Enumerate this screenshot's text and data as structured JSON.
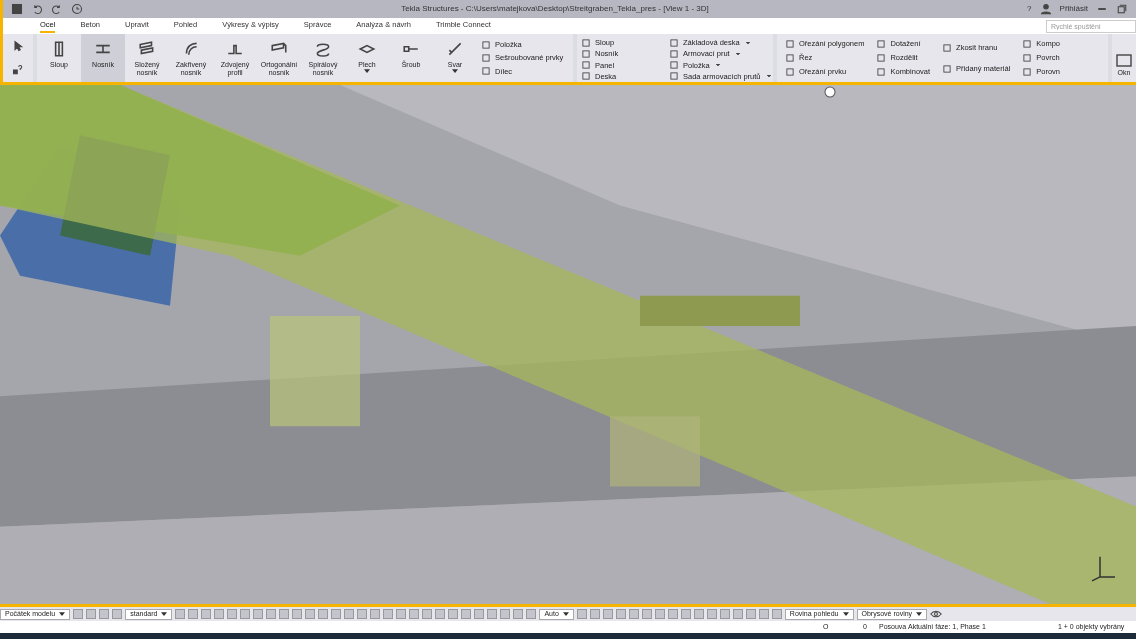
{
  "window": {
    "title": "Tekla Structures - C:\\Users\\matejkova\\Desktop\\Streitgraben_Tekla_pres  - [View 1 - 3D]",
    "help": "?",
    "login": "Přihlásit"
  },
  "tabs": [
    {
      "label": "Ocel",
      "selected": true
    },
    {
      "label": "Beton",
      "selected": false
    },
    {
      "label": "Upravit",
      "selected": false
    },
    {
      "label": "Pohled",
      "selected": false
    },
    {
      "label": "Výkresy & výpisy",
      "selected": false
    },
    {
      "label": "Správce",
      "selected": false
    },
    {
      "label": "Analýza & návrh",
      "selected": false
    },
    {
      "label": "Trimble Connect",
      "selected": false
    }
  ],
  "search": {
    "placeholder": "Rychlé spuštění"
  },
  "steel_tools": [
    {
      "label": "Sloup",
      "selected": false,
      "dropdown": false
    },
    {
      "label": "Nosník",
      "selected": true,
      "dropdown": false
    },
    {
      "label": "Složený nosník",
      "selected": false,
      "dropdown": false
    },
    {
      "label": "Zakřivený nosník",
      "selected": false,
      "dropdown": false
    },
    {
      "label": "Zdvojený profil",
      "selected": false,
      "dropdown": false
    },
    {
      "label": "Ortogonální nosník",
      "selected": false,
      "dropdown": false
    },
    {
      "label": "Spirálový nosník",
      "selected": false,
      "dropdown": false
    },
    {
      "label": "Plech",
      "selected": false,
      "dropdown": true
    },
    {
      "label": "Šroub",
      "selected": false,
      "dropdown": false
    },
    {
      "label": "Svar",
      "selected": false,
      "dropdown": true
    }
  ],
  "steel_small": [
    "Položka",
    "Sešroubované prvky",
    "Dílec"
  ],
  "concrete_columns": [
    [
      "Sloup",
      "Nosník",
      "Panel",
      "Deska"
    ],
    [
      "Základová deska",
      "Armovací prut",
      "Položka",
      "Sada armovacích prutů"
    ]
  ],
  "edit_columns": [
    [
      "Ořezání polygonem",
      "Řez",
      "Ořezání prvku"
    ],
    [
      "Dotažení",
      "Rozdělit",
      "Kombinovat"
    ],
    [
      "Zkosit hranu",
      "Přidaný materiál"
    ],
    [
      "Kompo",
      "Povrch",
      "Porovn"
    ]
  ],
  "window_group": {
    "label": "Okn"
  },
  "toolbar_dropdowns": [
    {
      "value": "Počátek modelu"
    },
    {
      "value": "standard"
    },
    {
      "value": "Auto"
    },
    {
      "value": "Rovina pohledu"
    },
    {
      "value": "Obrysové roviny"
    }
  ],
  "status_bar": [
    "O",
    "0",
    "Posouva",
    "Aktuální fáze: 1, Phase 1",
    "1 + 0 objekty vybrány"
  ]
}
